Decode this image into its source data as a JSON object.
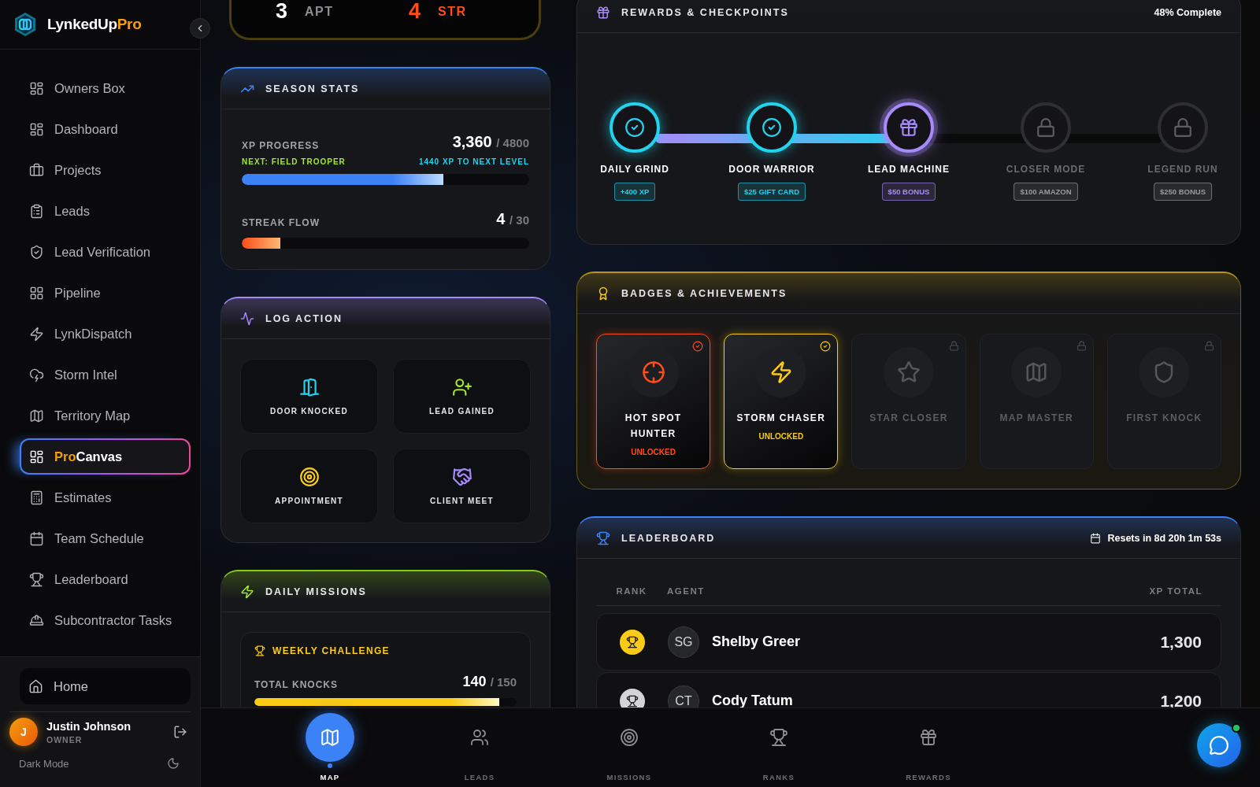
{
  "brand": {
    "name": "LynkedUp",
    "accent": "Pro"
  },
  "sidebar": {
    "items": [
      {
        "label": "Owners Box",
        "selected": false
      },
      {
        "label": "Dashboard",
        "selected": false
      },
      {
        "label": "Projects",
        "selected": false
      },
      {
        "label": "Leads",
        "selected": false
      },
      {
        "label": "Lead Verification",
        "selected": false
      },
      {
        "label": "Pipeline",
        "selected": false
      },
      {
        "label": "LynkDispatch",
        "selected": false
      },
      {
        "label": "Storm Intel",
        "selected": false
      },
      {
        "label": "Territory Map",
        "selected": false
      },
      {
        "prefix": "Pro",
        "label": "Canvas",
        "selected": true
      },
      {
        "label": "Estimates",
        "selected": false
      },
      {
        "label": "Team Schedule",
        "selected": false
      },
      {
        "label": "Leaderboard",
        "selected": false
      },
      {
        "label": "Subcontractor Tasks",
        "selected": false
      }
    ],
    "home": {
      "label": "Home"
    },
    "user": {
      "initial": "J",
      "name": "Justin Johnson",
      "role": "OWNER"
    },
    "theme": {
      "label": "Dark Mode"
    }
  },
  "stat_strip": [
    {
      "value": "3",
      "label": "APT",
      "color": "#ffffff"
    },
    {
      "value": "4",
      "label": "STR",
      "color": "#ff4d1a"
    }
  ],
  "season_stats": {
    "title": "SEASON STATS",
    "xp": {
      "label": "XP PROGRESS",
      "value": "3,360",
      "total": "/ 4800",
      "next": "NEXT: FIELD TROOPER",
      "remaining": "1440 XP TO NEXT LEVEL",
      "level": 0.7
    },
    "streak": {
      "label": "STREAK FLOW",
      "value": "4",
      "total": "/ 30",
      "level": 0.133
    }
  },
  "log_action": {
    "title": "LOG ACTION",
    "actions": [
      {
        "label": "DOOR KNOCKED",
        "color": "#22d3ee"
      },
      {
        "label": "LEAD GAINED",
        "color": "#a3e635"
      },
      {
        "label": "APPOINTMENT",
        "color": "#facc15"
      },
      {
        "label": "CLIENT MEET",
        "color": "#a78bfa"
      }
    ]
  },
  "daily_missions": {
    "title": "DAILY MISSIONS",
    "challenge": {
      "title": "WEEKLY CHALLENGE",
      "label": "TOTAL KNOCKS",
      "value": "140",
      "total": "/ 150",
      "level": 0.933
    }
  },
  "rewards": {
    "title": "REWARDS & CHECKPOINTS",
    "progress": "48% Complete",
    "checkpoints": [
      {
        "name": "DAILY GRIND",
        "reward": "+400 XP",
        "kind": "done"
      },
      {
        "name": "DOOR WARRIOR",
        "reward": "$25 GIFT CARD",
        "kind": "done"
      },
      {
        "name": "LEAD MACHINE",
        "reward": "$50 BONUS",
        "kind": "current"
      },
      {
        "name": "CLOSER MODE",
        "reward": "$100 AMAZON",
        "kind": "locked"
      },
      {
        "name": "LEGEND RUN",
        "reward": "$250 BONUS",
        "kind": "locked"
      }
    ]
  },
  "badges": {
    "title": "BADGES & ACHIEVEMENTS",
    "items": [
      {
        "name": "HOT SPOT HUNTER",
        "status": "UNLOCKED",
        "unlocked": true,
        "color": "#ff4d1a"
      },
      {
        "name": "STORM CHASER",
        "status": "UNLOCKED",
        "unlocked": true,
        "color": "#facc15"
      },
      {
        "name": "STAR CLOSER",
        "unlocked": false
      },
      {
        "name": "MAP MASTER",
        "unlocked": false
      },
      {
        "name": "FIRST KNOCK",
        "unlocked": false
      }
    ]
  },
  "leaderboard": {
    "title": "LEADERBOARD",
    "resets": "Resets in 8d 20h 1m 53s",
    "columns": [
      "RANK",
      "AGENT",
      "XP TOTAL"
    ],
    "rows": [
      {
        "initials": "SG",
        "name": "Shelby Greer",
        "xp": "1,300",
        "color": "#facc15"
      },
      {
        "initials": "CT",
        "name": "Cody Tatum",
        "xp": "1,200",
        "color": "#d4d4d8"
      }
    ]
  },
  "bottom_nav": [
    {
      "label": "MAP",
      "selected": true
    },
    {
      "label": "LEADS",
      "selected": false
    },
    {
      "label": "MISSIONS",
      "selected": false
    },
    {
      "label": "RANKS",
      "selected": false
    },
    {
      "label": "REWARDS",
      "selected": false
    }
  ],
  "chat": {
    "online": true
  }
}
